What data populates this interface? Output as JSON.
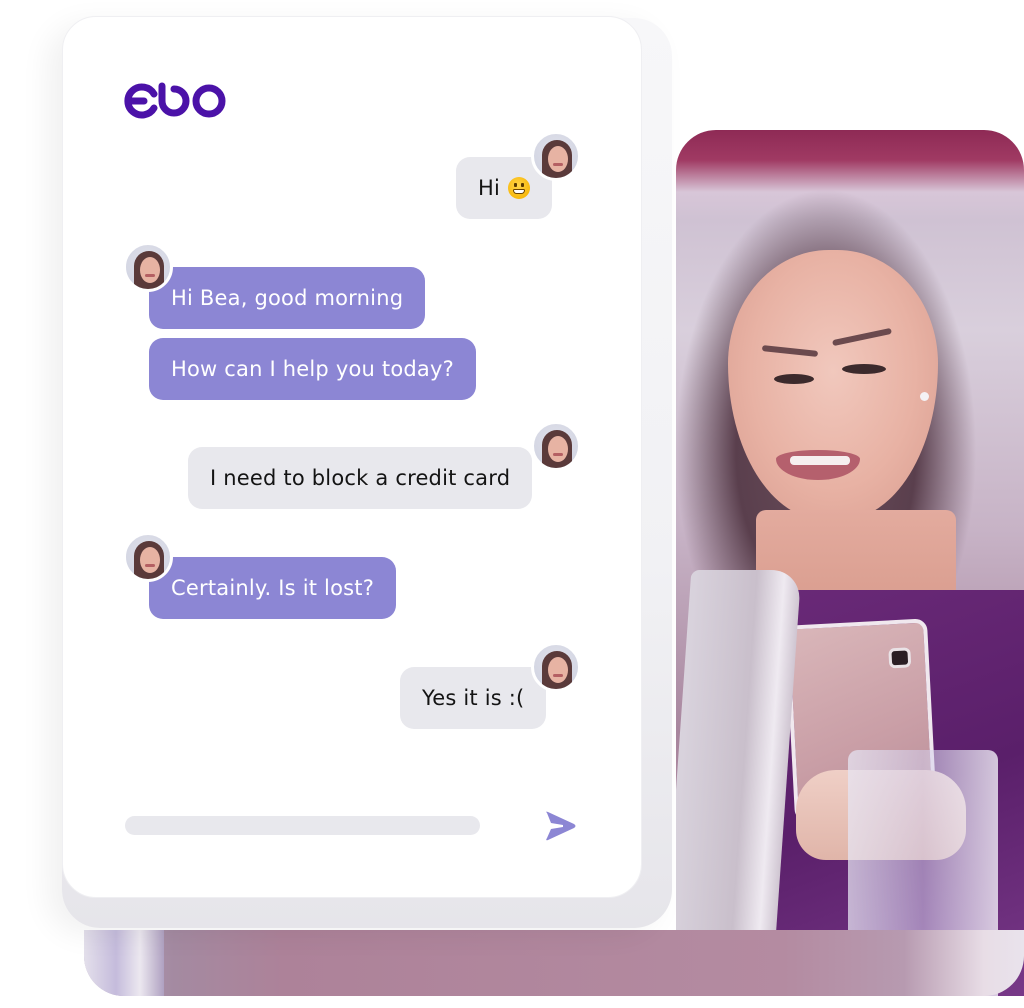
{
  "brand": {
    "logo_text": "ebo",
    "primary_color": "#4b12a8",
    "agent_bubble_color": "#8c86d4",
    "user_bubble_color": "#e8e8ed"
  },
  "chat": {
    "messages": [
      {
        "sender": "user",
        "text": "Hi",
        "emoji": "grinning-face",
        "avatar": "user-avatar"
      },
      {
        "sender": "agent",
        "text": "Hi Bea, good morning",
        "avatar": "agent-avatar"
      },
      {
        "sender": "agent",
        "text": "How can I help you today?"
      },
      {
        "sender": "user",
        "text": "I need to block a credit card",
        "avatar": "user-avatar"
      },
      {
        "sender": "agent",
        "text": "Certainly. Is it lost?",
        "avatar": "agent-avatar"
      },
      {
        "sender": "user",
        "text": "Yes it is :(",
        "avatar": "user-avatar"
      }
    ]
  },
  "composer": {
    "value": "",
    "send_icon": "send-icon"
  },
  "photo": {
    "subject": "woman-smiling-at-phone"
  }
}
